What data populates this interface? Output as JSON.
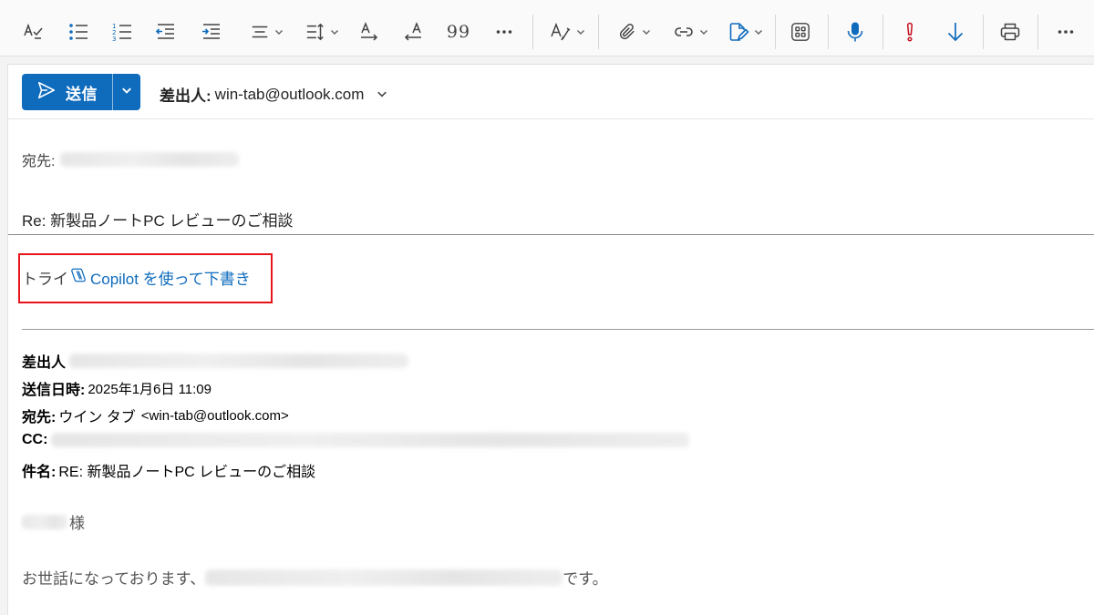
{
  "toolbar": {
    "items": [
      {
        "name": "spelling-icon"
      },
      {
        "name": "bullet-list-icon"
      },
      {
        "name": "numbered-list-icon"
      },
      {
        "name": "decrease-indent-icon"
      },
      {
        "name": "increase-indent-icon"
      },
      {
        "name": "align-icon"
      },
      {
        "name": "line-spacing-icon"
      },
      {
        "name": "ltr-direction-icon"
      },
      {
        "name": "rtl-direction-icon"
      },
      {
        "name": "quote-icon"
      },
      {
        "name": "more-format-icon"
      },
      {
        "name": "editor-icon"
      },
      {
        "name": "attach-icon"
      },
      {
        "name": "link-icon"
      },
      {
        "name": "signature-icon"
      },
      {
        "name": "apps-icon"
      },
      {
        "name": "dictate-icon"
      },
      {
        "name": "high-importance-icon"
      },
      {
        "name": "low-importance-icon"
      },
      {
        "name": "print-icon"
      },
      {
        "name": "more-options-icon"
      }
    ],
    "quote_glyph": "99",
    "accent_color": "#0f6cbd",
    "importance_color": "#c50f1f"
  },
  "compose": {
    "send_label": "送信",
    "from_label": "差出人:",
    "from_value": "win-tab@outlook.com",
    "to_label": "宛先:",
    "subject": "Re: 新製品ノートPC レビューのご相談"
  },
  "copilot": {
    "try_text": "トライ",
    "link_text": "Copilot を使って下書き",
    "highlight_color": "#e8141b"
  },
  "quoted": {
    "from_label": "差出人",
    "sent_label": "送信日時:",
    "sent_value": "2025年1月6日 11:09",
    "to_label": "宛先:",
    "to_name": "ウイン タブ",
    "to_email": "<win-tab@outlook.com>",
    "cc_label": "CC:",
    "subject_label": "件名:",
    "subject_value": "RE: 新製品ノートPC レビューのご相談"
  },
  "body": {
    "greeting_suffix": "様",
    "line1_start": "お世話になっております、",
    "line1_end": "です。"
  }
}
